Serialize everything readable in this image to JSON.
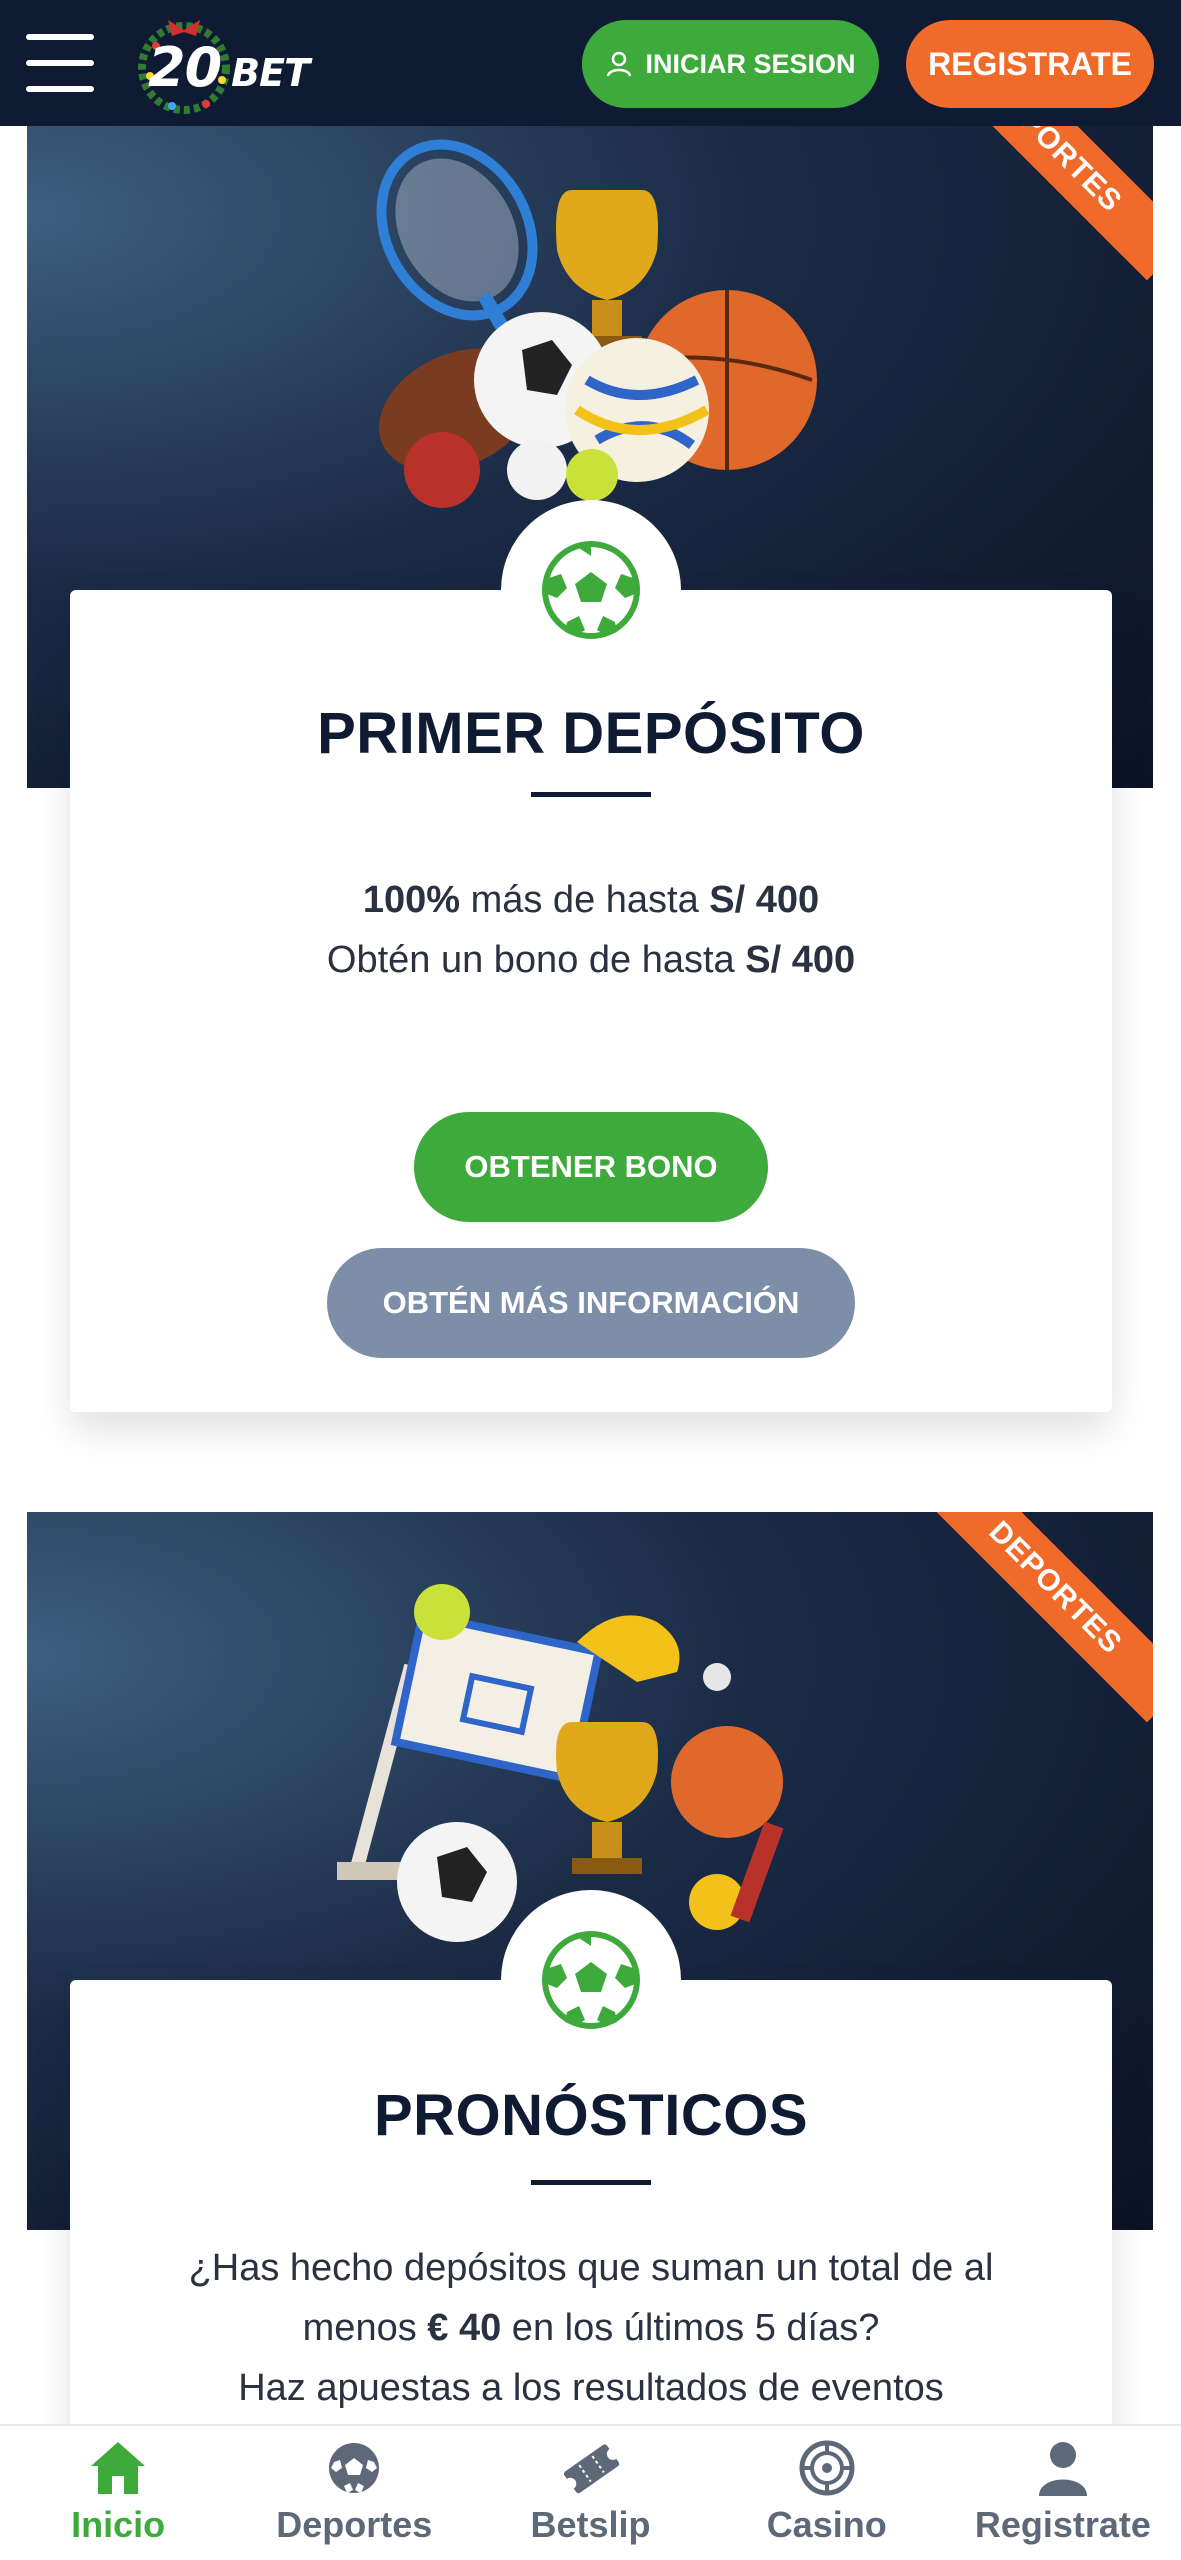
{
  "header": {
    "logo_text": "20",
    "logo_suffix": "BET",
    "login_label": "INICIAR SESION",
    "register_label": "REGISTRATE"
  },
  "promos": [
    {
      "ribbon": "DEPORTES",
      "title": "PRIMER DEPÓSITO",
      "line1_bold": "100%",
      "line1_mid": " más de hasta ",
      "line1_amount": "S/ 400",
      "line2_text": "Obtén un bono de hasta ",
      "line2_amount": "S/ 400",
      "primary_button": "OBTENER BONO",
      "secondary_button": "OBTÉN MÁS INFORMACIÓN"
    },
    {
      "ribbon": "DEPORTES",
      "title": "PRONÓSTICOS",
      "text_line1": "¿Has hecho depósitos que suman un total de al",
      "text_line2_pre": "menos ",
      "text_line2_amount": "€ 40",
      "text_line2_post": " en los últimos 5 días?",
      "text_line3": "Haz apuestas a los resultados de eventos"
    }
  ],
  "bottom_nav": [
    {
      "label": "Inicio",
      "icon": "home-icon",
      "active": true
    },
    {
      "label": "Deportes",
      "icon": "soccer-ball-icon",
      "active": false
    },
    {
      "label": "Betslip",
      "icon": "ticket-icon",
      "active": false
    },
    {
      "label": "Casino",
      "icon": "roulette-icon",
      "active": false
    },
    {
      "label": "Registrate",
      "icon": "user-icon",
      "active": false
    }
  ],
  "colors": {
    "header_bg": "#0f1b33",
    "green": "#3eaa3b",
    "orange": "#f06a2a",
    "grey_button": "#7d8ea9"
  }
}
